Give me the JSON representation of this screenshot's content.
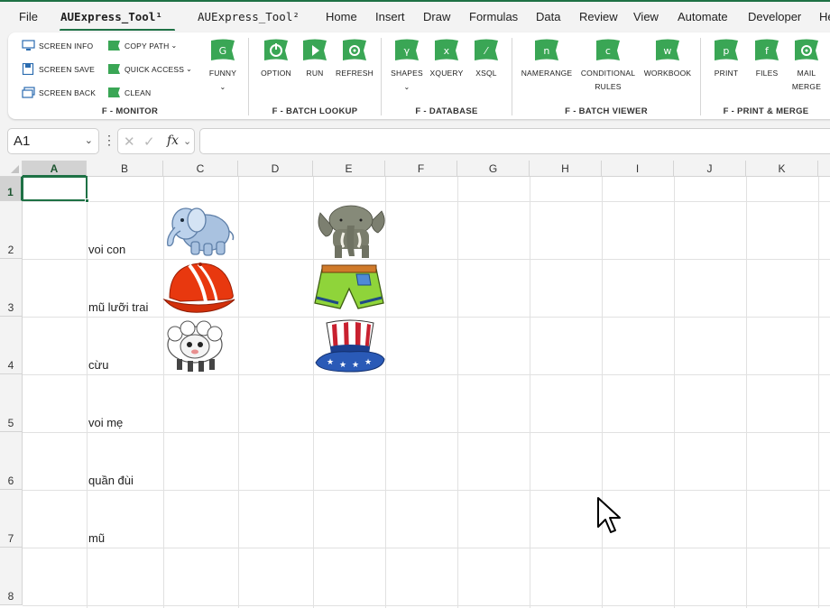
{
  "menu": {
    "items": [
      {
        "label": "File"
      },
      {
        "label": "AUExpress_Tool¹"
      },
      {
        "label": "AUExpress_Tool²"
      },
      {
        "label": "Home"
      },
      {
        "label": "Insert"
      },
      {
        "label": "Draw"
      },
      {
        "label": "Formulas"
      },
      {
        "label": "Data"
      },
      {
        "label": "Review"
      },
      {
        "label": "View"
      },
      {
        "label": "Automate"
      },
      {
        "label": "Developer"
      },
      {
        "label": "He"
      }
    ],
    "active_tab": "AUExpress_Tool¹"
  },
  "ribbon": {
    "monitor": {
      "label": "F - MONITOR",
      "buttons": {
        "screen_info": "SCREEN INFO",
        "screen_save": "SCREEN SAVE",
        "screen_back": "SCREEN BACK",
        "copy_path": "COPY PATH",
        "quick_access": "QUICK ACCESS",
        "clean": "CLEAN",
        "funny": "FUNNY"
      }
    },
    "batch_lookup": {
      "label": "F - BATCH LOOKUP",
      "buttons": {
        "option": "OPTION",
        "run": "RUN",
        "refresh": "REFRESH"
      }
    },
    "database": {
      "label": "F - DATABASE",
      "buttons": {
        "shapes": "SHAPES",
        "xquery": "XQUERY",
        "xsql": "XSQL"
      }
    },
    "batch_viewer": {
      "label": "F - BATCH VIEWER",
      "buttons": {
        "namerange": "NAMERANGE",
        "conditional_1": "CONDITIONAL",
        "conditional_2": "RULES",
        "workbook": "WORKBOOK"
      }
    },
    "print_merge": {
      "label": "F - PRINT & MERGE",
      "buttons": {
        "print": "PRINT",
        "files": "FILES",
        "mail_1": "MAIL",
        "mail_2": "MERGE"
      }
    },
    "icon_color": "#3aa655"
  },
  "formula_bar": {
    "name_box": "A1",
    "formula": ""
  },
  "sheet": {
    "columns": [
      "A",
      "B",
      "C",
      "D",
      "E",
      "F",
      "G",
      "H",
      "I",
      "J",
      "K"
    ],
    "rows": [
      "1",
      "2",
      "3",
      "4",
      "5",
      "6",
      "7",
      "8"
    ],
    "selected_cell": "A1",
    "cells": {
      "B2": "voi con",
      "B3": "mũ lưỡi trai",
      "B4": "cừu",
      "B5": "voi mẹ",
      "B6": "quần đùi",
      "B7": "mũ"
    },
    "pictures": {
      "C2": "baby-elephant-cartoon",
      "E2": "adult-elephant-photo",
      "C3": "red-baseball-cap",
      "E3": "green-shorts",
      "C4": "cartoon-sheep",
      "E4": "uncle-sam-top-hat"
    },
    "accent_color": "#1e7145"
  }
}
